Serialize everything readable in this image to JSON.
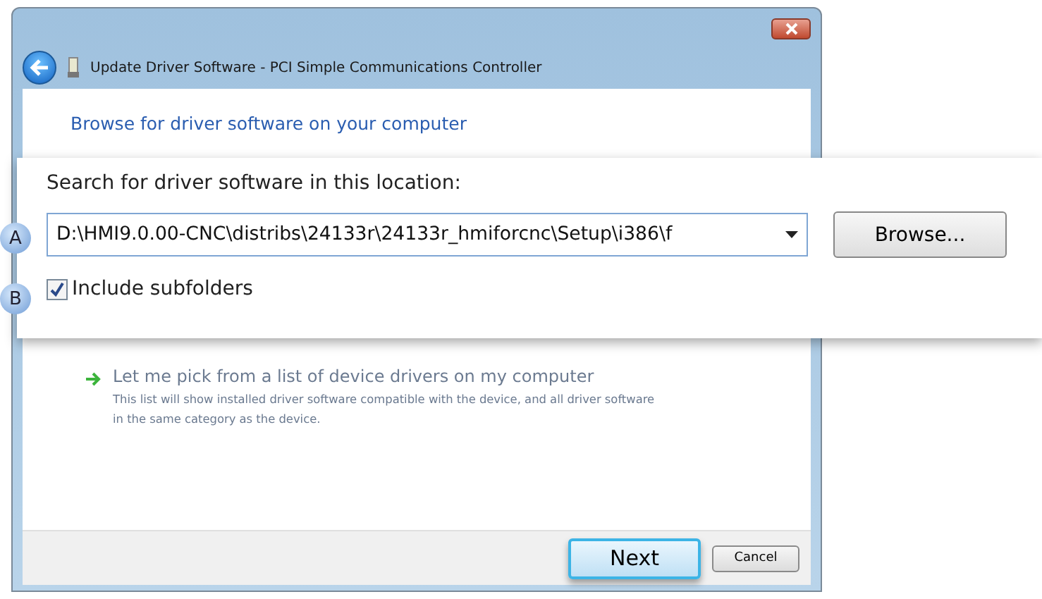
{
  "window": {
    "title": "Update Driver Software - PCI Simple Communications Controller"
  },
  "heading": "Browse for driver software on your computer",
  "callout": {
    "label": "Search for driver software in this location:",
    "location": {
      "value": "D:\\HMI9.0.00-CNC\\distribs\\24133r\\24133r_hmiforcnc\\Setup\\i386\\f",
      "badge": "A"
    },
    "browse_button": "Browse...",
    "include_subfolders": {
      "label": "Include subfolders",
      "checked": true,
      "badge": "B"
    }
  },
  "pick_option": {
    "title": "Let me pick from a list of device drivers on my computer",
    "description": "This list will show installed driver software compatible with the device, and all driver software in the same category as the device."
  },
  "buttons": [
    {
      "label": "Next",
      "kind": "primary"
    },
    {
      "label": "Cancel",
      "kind": "secondary"
    }
  ]
}
